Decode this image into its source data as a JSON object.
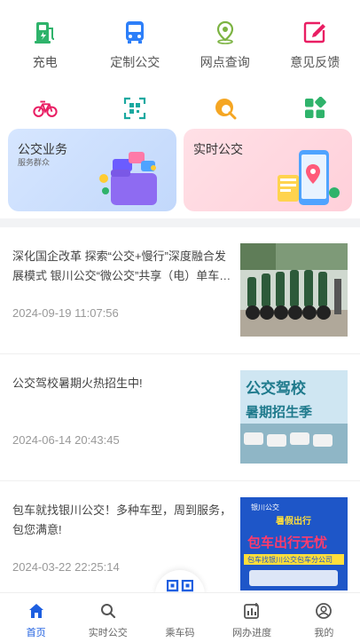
{
  "grid": {
    "row1": [
      {
        "label": "充电",
        "icon": "charging-station-icon"
      },
      {
        "label": "定制公交",
        "icon": "bus-icon"
      },
      {
        "label": "网点查询",
        "icon": "location-pin-icon"
      },
      {
        "label": "意见反馈",
        "icon": "edit-feedback-icon"
      }
    ],
    "row2": [
      {
        "icon": "bicycle-icon"
      },
      {
        "icon": "qr-scan-icon"
      },
      {
        "icon": "search-location-icon"
      },
      {
        "icon": "apps-grid-icon"
      }
    ]
  },
  "cards": {
    "bus_business": {
      "title": "公交业务",
      "subtitle": "服务群众"
    },
    "realtime_bus": {
      "title": "实时公交"
    }
  },
  "news": [
    {
      "title": "深化国企改革 探索“公交+慢行”深度融合发展模式 银川公交“微公交”共享（电）单车…",
      "date": "2024-09-19 11:07:56",
      "thumb": "electric-bikes-photo"
    },
    {
      "title": "公交驾校暑期火热招生中!",
      "date": "2024-06-14 20:43:45",
      "thumb": "driving-school-banner",
      "thumb_text": {
        "line1": "公交驾校",
        "line2": "暑期招生季"
      }
    },
    {
      "title": "包车就找银川公交！多种车型，周到服务，包您满意!",
      "date": "2024-03-22 22:25:14",
      "thumb": "charter-bus-poster",
      "thumb_text": {
        "brand": "银川公交",
        "slogan1": "暑假出行",
        "slogan2": "包车出行无忧",
        "footer": "包车找银川公交包车分公司"
      }
    }
  ],
  "tabbar": {
    "items": [
      {
        "label": "首页",
        "icon": "home-icon",
        "active": true
      },
      {
        "label": "实时公交",
        "icon": "search-icon"
      },
      {
        "label": "乘车码",
        "icon": "qr-code-icon"
      },
      {
        "label": "网办进度",
        "icon": "progress-chart-icon"
      },
      {
        "label": "我的",
        "icon": "user-icon"
      }
    ]
  },
  "colors": {
    "accent": "#1e5fe0",
    "green": "#2fb36b",
    "blue": "#2d7ff9",
    "olive": "#7cb342",
    "pink": "#e91e63",
    "orange": "#f5a623"
  }
}
